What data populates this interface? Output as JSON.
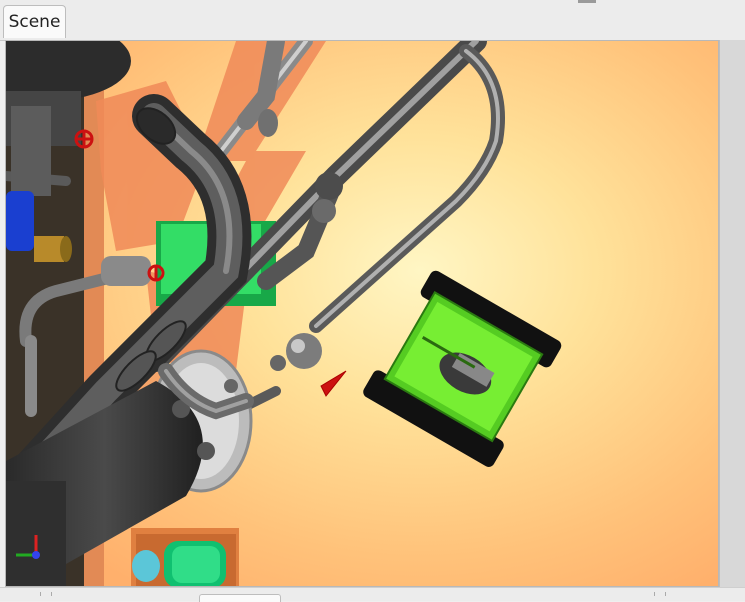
{
  "tabs": [
    {
      "label": "Scene",
      "active": true
    }
  ],
  "scene": {
    "colors": {
      "floor_light": "#fff2b0",
      "floor_mid": "#ffd080",
      "floor_dark": "#ffa860",
      "shadow": "#f08050",
      "pipe": "#6e6e6e",
      "pipe_dark": "#3a3a3a",
      "vessel": "#3c3c3c",
      "green_block": "#22cc55",
      "robot_body": "#66dd22",
      "valve_red": "#cc1111",
      "blue_part": "#1a3fd0",
      "brass": "#b88a2a",
      "cyan_part": "#5bc6d8",
      "teal_motor": "#10c070"
    },
    "objects": [
      {
        "name": "process-vessel",
        "label": ""
      },
      {
        "name": "overhead-pipe-network",
        "label": ""
      },
      {
        "name": "mobile-robot",
        "label": ""
      },
      {
        "name": "green-control-block",
        "label": ""
      },
      {
        "name": "valve-handwheels",
        "label": ""
      },
      {
        "name": "pump-motor-assembly",
        "label": ""
      }
    ],
    "axis_gizmo": [
      "x",
      "y",
      "z"
    ]
  }
}
